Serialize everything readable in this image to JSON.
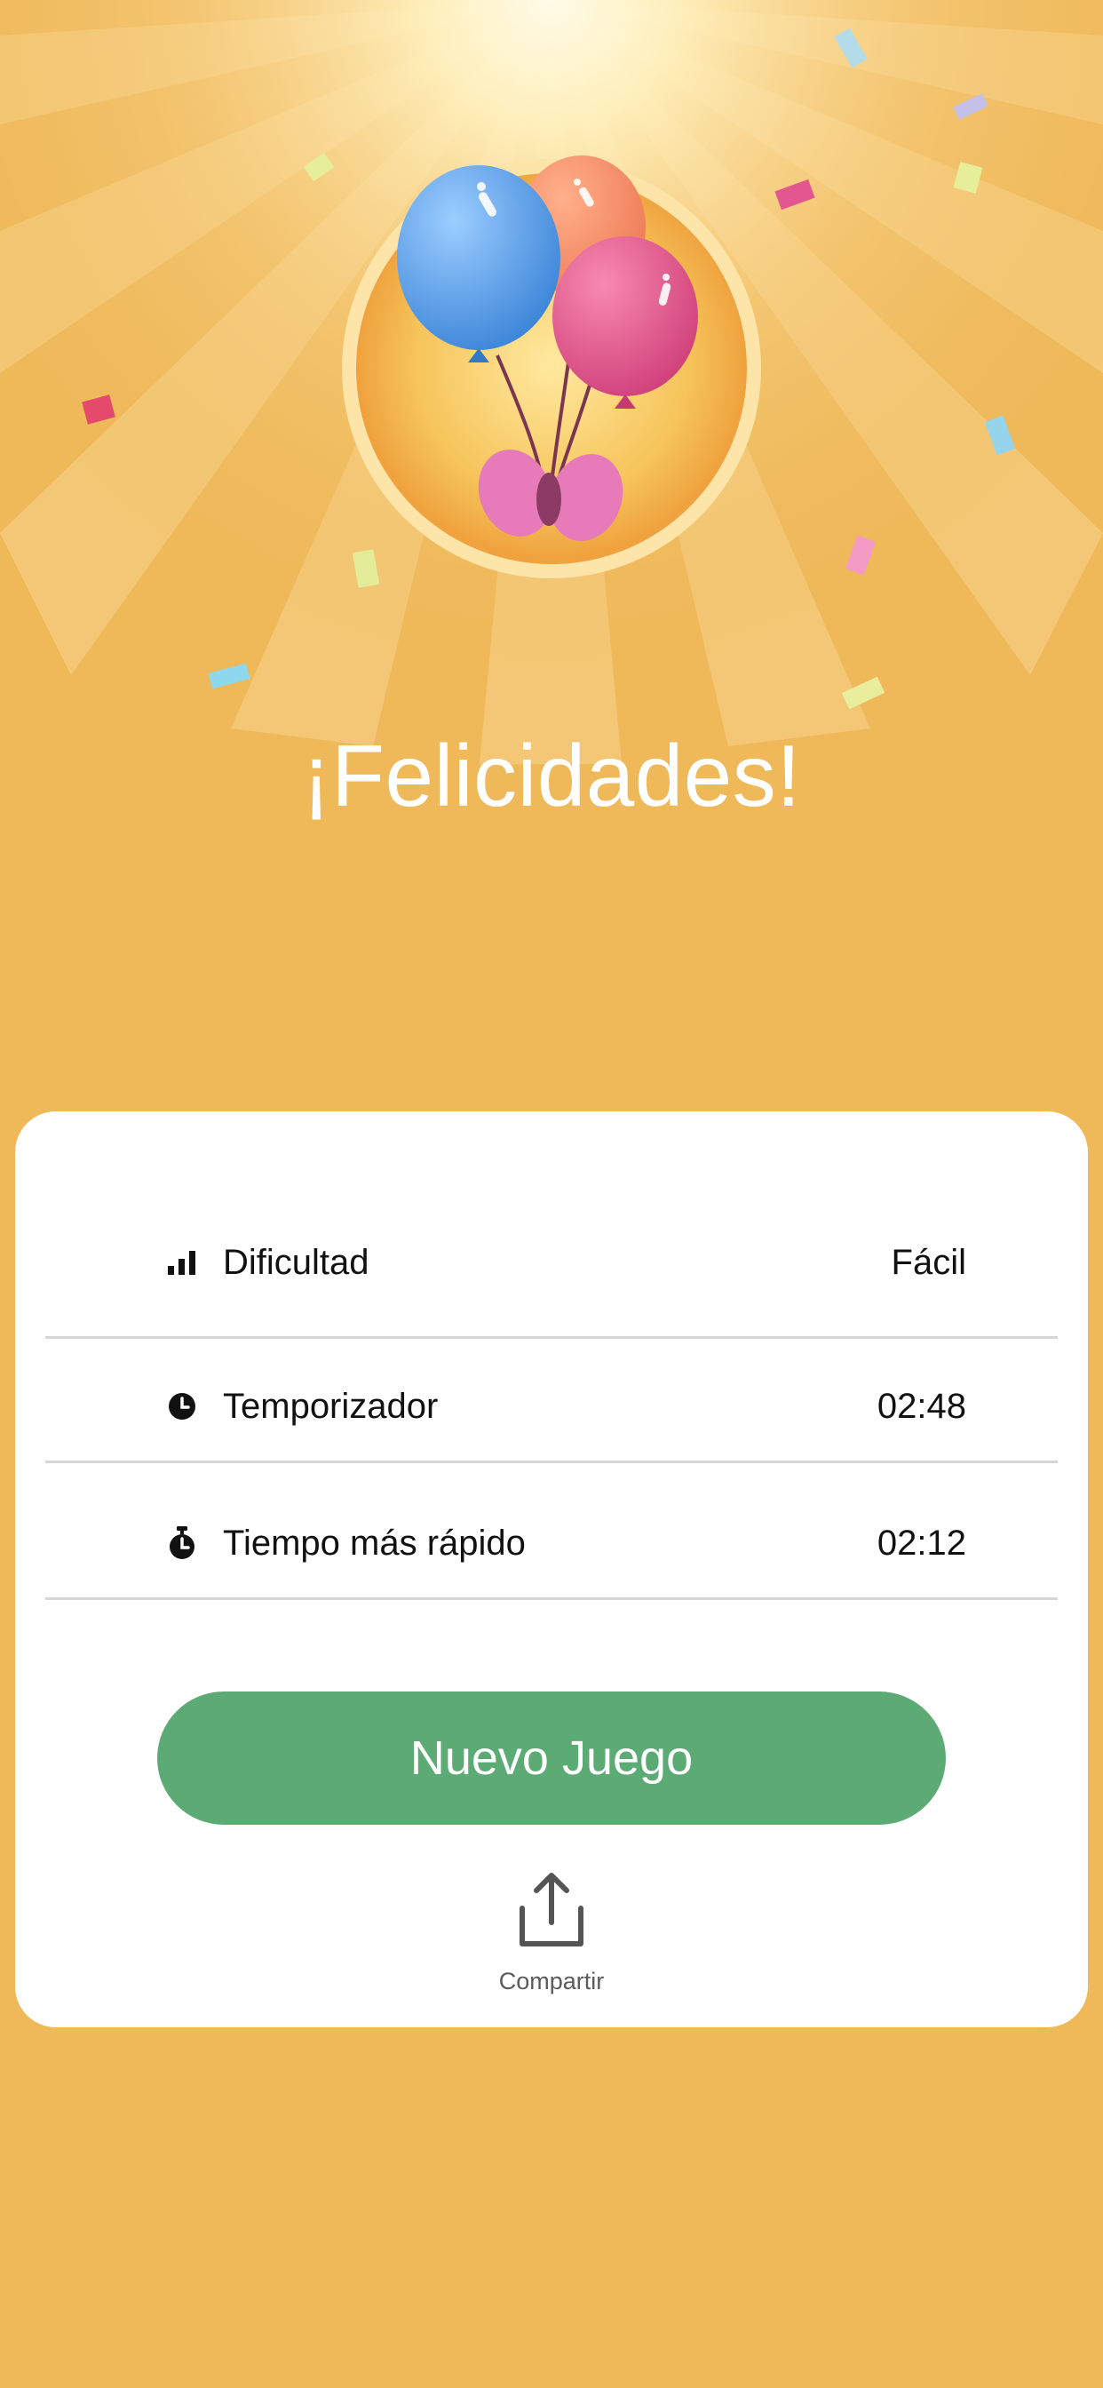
{
  "colors": {
    "background": "#efb95a",
    "card": "#ffffff",
    "button": "#5caa74"
  },
  "header": {
    "title": "¡Felicidades!"
  },
  "stats": [
    {
      "icon": "bar-chart-icon",
      "label": "Dificultad",
      "value": "Fácil"
    },
    {
      "icon": "clock-icon",
      "label": "Temporizador",
      "value": "02:48"
    },
    {
      "icon": "stopwatch-icon",
      "label": "Tiempo más rápido",
      "value": "02:12"
    }
  ],
  "actions": {
    "new_game_label": "Nuevo Juego",
    "share_label": "Compartir",
    "share_icon": "share-icon"
  }
}
